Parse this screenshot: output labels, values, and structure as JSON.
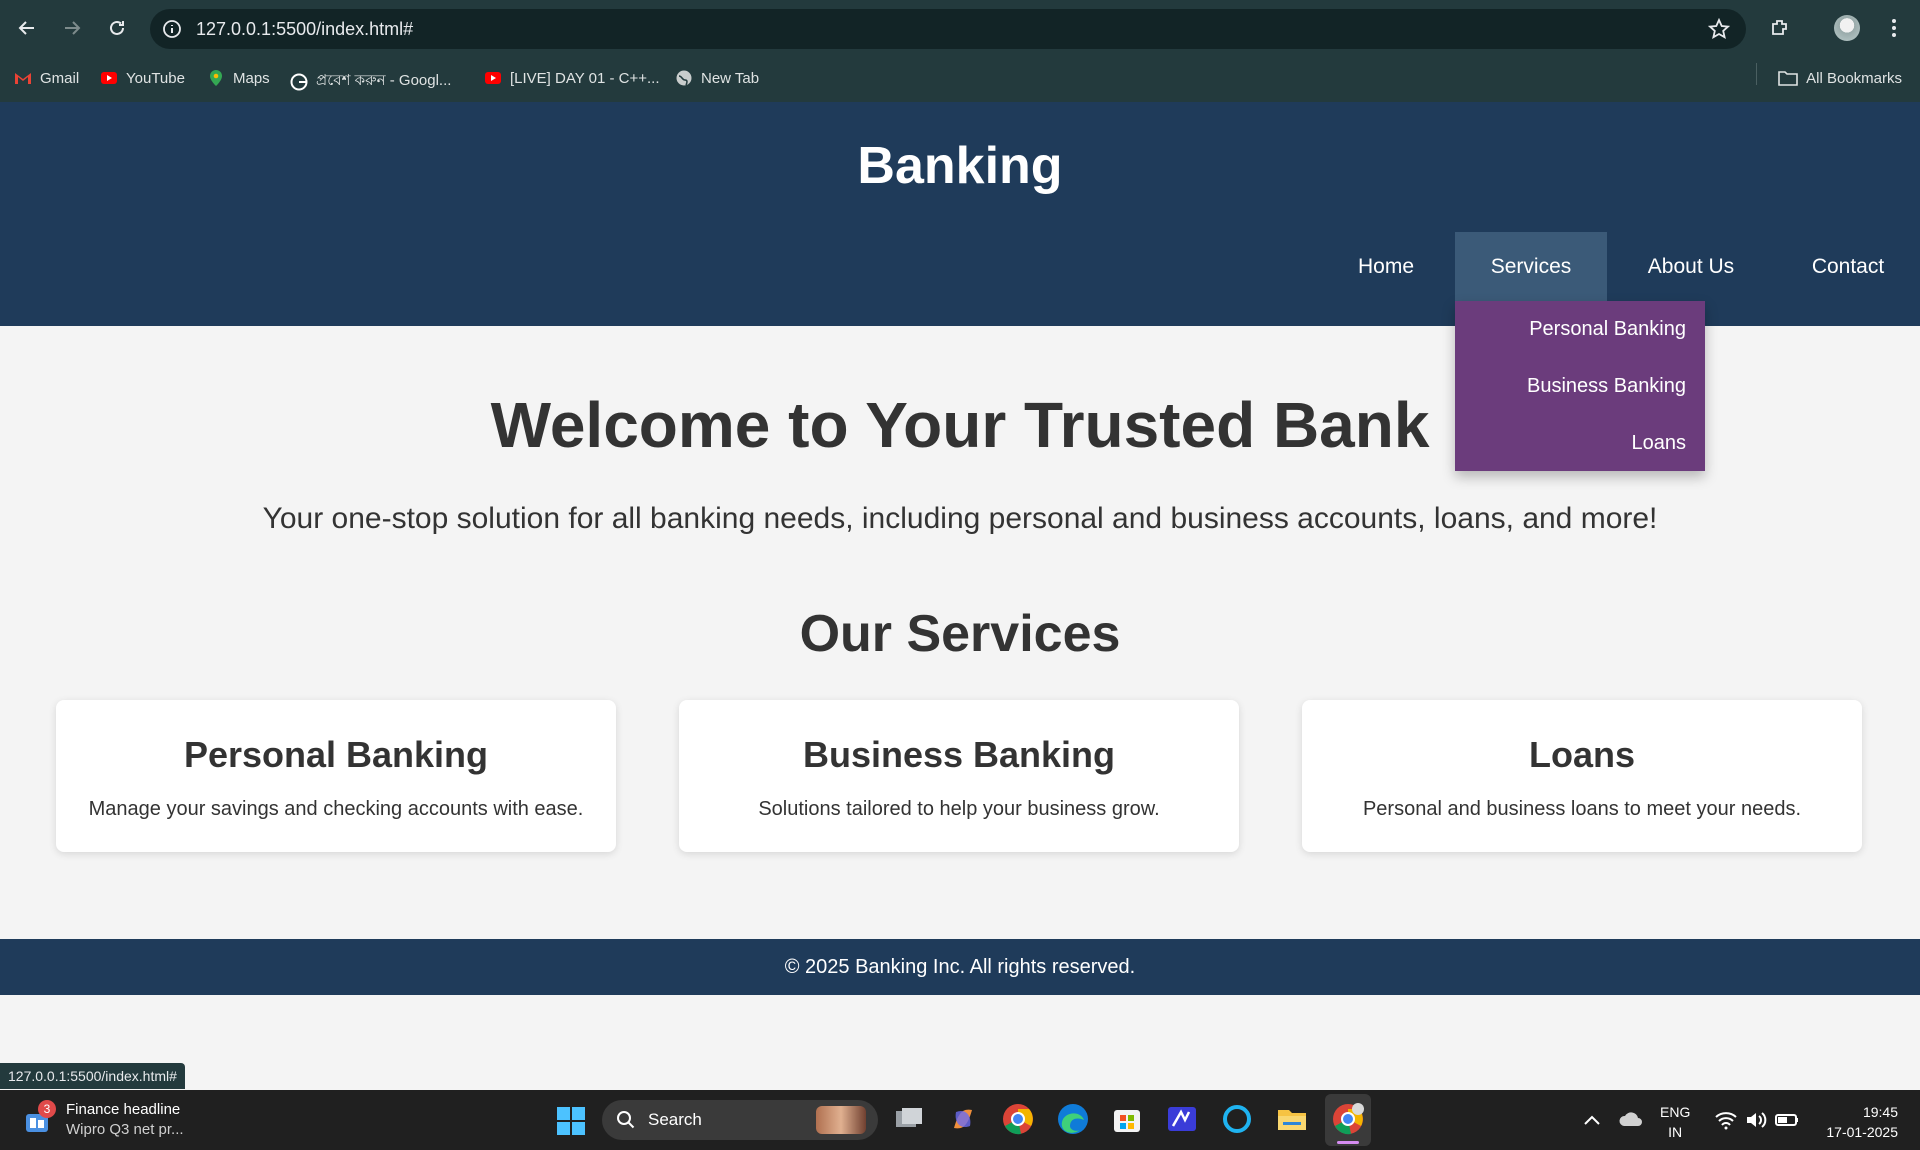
{
  "browser": {
    "url": "127.0.0.1:5500/index.html#",
    "bookmarks": [
      {
        "label": "Gmail",
        "icon": "gmail-icon"
      },
      {
        "label": "YouTube",
        "icon": "youtube-icon"
      },
      {
        "label": "Maps",
        "icon": "maps-icon"
      },
      {
        "label": "প্রবেশ করুন - Googl...",
        "icon": "google-icon"
      },
      {
        "label": "[LIVE] DAY 01 - C++...",
        "icon": "youtube-icon"
      },
      {
        "label": "New Tab",
        "icon": "globe-icon"
      }
    ],
    "all_bookmarks": "All Bookmarks",
    "status_url": "127.0.0.1:5500/index.html#"
  },
  "site": {
    "title": "Banking",
    "nav": [
      {
        "label": "Home"
      },
      {
        "label": "Services",
        "active": true
      },
      {
        "label": "About Us"
      },
      {
        "label": "Contact"
      }
    ],
    "dropdown": [
      "Personal Banking",
      "Business Banking",
      "Loans"
    ],
    "welcome": "Welcome to Your Trusted Bank",
    "tagline": "Your one-stop solution for all banking needs, including personal and business accounts, loans, and more!",
    "services_heading": "Our Services",
    "cards": [
      {
        "title": "Personal Banking",
        "text": "Manage your savings and checking accounts with ease."
      },
      {
        "title": "Business Banking",
        "text": "Solutions tailored to help your business grow."
      },
      {
        "title": "Loans",
        "text": "Personal and business loans to meet your needs."
      }
    ],
    "footer": "© 2025 Banking Inc. All rights reserved."
  },
  "colors": {
    "header_bg": "#1f3b5a",
    "nav_active_bg": "#3b5a78",
    "dropdown_bg": "#6b3c7c",
    "page_bg": "#f4f4f4"
  },
  "taskbar": {
    "widget_badge": "3",
    "widget_title": "Finance headline",
    "widget_sub": "Wipro Q3 net pr...",
    "search": "Search",
    "lang_1": "ENG",
    "lang_2": "IN",
    "time": "19:45",
    "date": "17-01-2025"
  }
}
